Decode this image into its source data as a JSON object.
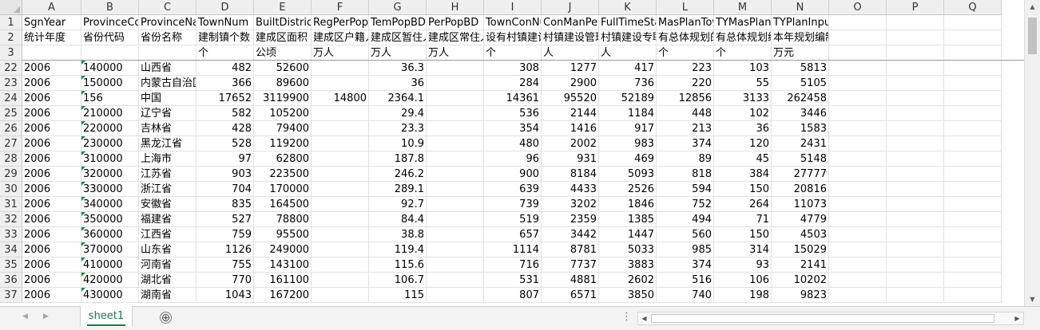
{
  "columns": [
    {
      "letter": "A",
      "width": 74,
      "align": "left"
    },
    {
      "letter": "B",
      "width": 72,
      "align": "left",
      "text_number": true
    },
    {
      "letter": "C",
      "width": 72,
      "align": "left"
    },
    {
      "letter": "D",
      "width": 72,
      "align": "right"
    },
    {
      "letter": "E",
      "width": 72,
      "align": "right"
    },
    {
      "letter": "F",
      "width": 72,
      "align": "right"
    },
    {
      "letter": "G",
      "width": 72,
      "align": "right"
    },
    {
      "letter": "H",
      "width": 72,
      "align": "right"
    },
    {
      "letter": "I",
      "width": 72,
      "align": "right"
    },
    {
      "letter": "J",
      "width": 72,
      "align": "right"
    },
    {
      "letter": "K",
      "width": 72,
      "align": "right"
    },
    {
      "letter": "L",
      "width": 72,
      "align": "right"
    },
    {
      "letter": "M",
      "width": 72,
      "align": "right"
    },
    {
      "letter": "N",
      "width": 72,
      "align": "right"
    },
    {
      "letter": "O",
      "width": 72,
      "align": "right"
    },
    {
      "letter": "P",
      "width": 72,
      "align": "right"
    },
    {
      "letter": "Q",
      "width": 72,
      "align": "right"
    }
  ],
  "header_rows": [
    {
      "num": "1",
      "cells": [
        "SgnYear",
        "ProvinceCode",
        "ProvinceName",
        "TownNum",
        "BuiltDistrictArea",
        "RegPerPop",
        "TemPopBD",
        "PerPopBD",
        "TownConNum",
        "ConManPer",
        "FullTimeStaff",
        "MasPlanTown",
        "TYMasPlan",
        "TYPlanInput",
        "",
        "",
        ""
      ]
    },
    {
      "num": "2",
      "cells": [
        "统计年度",
        "省份代码",
        "省份名称",
        "建制镇个数",
        "建成区面积",
        "建成区户籍人口",
        "建成区暂住人口",
        "建成区常住人口",
        "设有村镇建设管理机构",
        "村镇建设管理人员",
        "村镇建设专职人员",
        "有总体规划的建制镇",
        "有总体规划编制",
        "本年规划编制投入",
        "",
        "",
        ""
      ]
    },
    {
      "num": "3",
      "cells": [
        "",
        "",
        "",
        "个",
        "公顷",
        "万人",
        "万人",
        "万人",
        "个",
        "人",
        "人",
        "个",
        "个",
        "万元",
        "",
        "",
        ""
      ]
    }
  ],
  "data_rows": [
    {
      "num": "22",
      "cells": [
        "2006",
        "140000",
        "山西省",
        "482",
        "52600",
        "",
        "36.3",
        "",
        "308",
        "1277",
        "417",
        "223",
        "103",
        "5813",
        "",
        "",
        ""
      ]
    },
    {
      "num": "23",
      "cells": [
        "2006",
        "150000",
        "内蒙古自治区",
        "366",
        "89600",
        "",
        "36",
        "",
        "284",
        "2900",
        "736",
        "220",
        "55",
        "5105",
        "",
        "",
        ""
      ]
    },
    {
      "num": "24",
      "cells": [
        "2006",
        "156",
        "中国",
        "17652",
        "3119900",
        "14800",
        "2364.1",
        "",
        "14361",
        "95520",
        "52189",
        "12856",
        "3133",
        "262458",
        "",
        "",
        ""
      ]
    },
    {
      "num": "25",
      "cells": [
        "2006",
        "210000",
        "辽宁省",
        "582",
        "105200",
        "",
        "29.4",
        "",
        "536",
        "2144",
        "1184",
        "448",
        "102",
        "3446",
        "",
        "",
        ""
      ]
    },
    {
      "num": "26",
      "cells": [
        "2006",
        "220000",
        "吉林省",
        "428",
        "79400",
        "",
        "23.3",
        "",
        "354",
        "1416",
        "917",
        "213",
        "36",
        "1583",
        "",
        "",
        ""
      ]
    },
    {
      "num": "27",
      "cells": [
        "2006",
        "230000",
        "黑龙江省",
        "528",
        "119200",
        "",
        "10.9",
        "",
        "480",
        "2002",
        "983",
        "374",
        "120",
        "2431",
        "",
        "",
        ""
      ]
    },
    {
      "num": "28",
      "cells": [
        "2006",
        "310000",
        "上海市",
        "97",
        "62800",
        "",
        "187.8",
        "",
        "96",
        "931",
        "469",
        "89",
        "45",
        "5148",
        "",
        "",
        ""
      ]
    },
    {
      "num": "29",
      "cells": [
        "2006",
        "320000",
        "江苏省",
        "903",
        "223500",
        "",
        "246.2",
        "",
        "900",
        "8184",
        "5093",
        "818",
        "384",
        "27777",
        "",
        "",
        ""
      ]
    },
    {
      "num": "30",
      "cells": [
        "2006",
        "330000",
        "浙江省",
        "704",
        "170000",
        "",
        "289.1",
        "",
        "639",
        "4433",
        "2526",
        "594",
        "150",
        "20816",
        "",
        "",
        ""
      ]
    },
    {
      "num": "31",
      "cells": [
        "2006",
        "340000",
        "安徽省",
        "835",
        "164500",
        "",
        "92.7",
        "",
        "739",
        "3202",
        "1846",
        "752",
        "264",
        "11073",
        "",
        "",
        ""
      ]
    },
    {
      "num": "32",
      "cells": [
        "2006",
        "350000",
        "福建省",
        "527",
        "78800",
        "",
        "84.4",
        "",
        "519",
        "2359",
        "1385",
        "494",
        "71",
        "4779",
        "",
        "",
        ""
      ]
    },
    {
      "num": "33",
      "cells": [
        "2006",
        "360000",
        "江西省",
        "759",
        "95500",
        "",
        "38.8",
        "",
        "657",
        "3442",
        "1447",
        "560",
        "150",
        "4503",
        "",
        "",
        ""
      ]
    },
    {
      "num": "34",
      "cells": [
        "2006",
        "370000",
        "山东省",
        "1126",
        "249000",
        "",
        "119.4",
        "",
        "1114",
        "8781",
        "5033",
        "985",
        "314",
        "15029",
        "",
        "",
        ""
      ]
    },
    {
      "num": "35",
      "cells": [
        "2006",
        "410000",
        "河南省",
        "755",
        "143100",
        "",
        "115.6",
        "",
        "716",
        "7737",
        "3883",
        "374",
        "93",
        "2141",
        "",
        "",
        ""
      ]
    },
    {
      "num": "36",
      "cells": [
        "2006",
        "420000",
        "湖北省",
        "770",
        "161100",
        "",
        "106.7",
        "",
        "531",
        "4881",
        "2602",
        "516",
        "106",
        "10202",
        "",
        "",
        ""
      ]
    },
    {
      "num": "37",
      "cells": [
        "2006",
        "430000",
        "湖南省",
        "1043",
        "167200",
        "",
        "115",
        "",
        "807",
        "6571",
        "3850",
        "740",
        "198",
        "9823",
        "",
        "",
        ""
      ]
    }
  ],
  "sheet_tab": {
    "label": "sheet1"
  },
  "add_sheet_label": "⊕",
  "dots_label": "⋮",
  "icons": {
    "tab_prev": "left-triangle",
    "tab_next": "right-triangle",
    "scroll_up": "up-triangle",
    "scroll_down": "down-triangle",
    "scroll_left": "left-triangle",
    "scroll_right": "right-triangle"
  },
  "colors": {
    "accent": "#217346",
    "text_number_marker": "#1e8a3c"
  }
}
